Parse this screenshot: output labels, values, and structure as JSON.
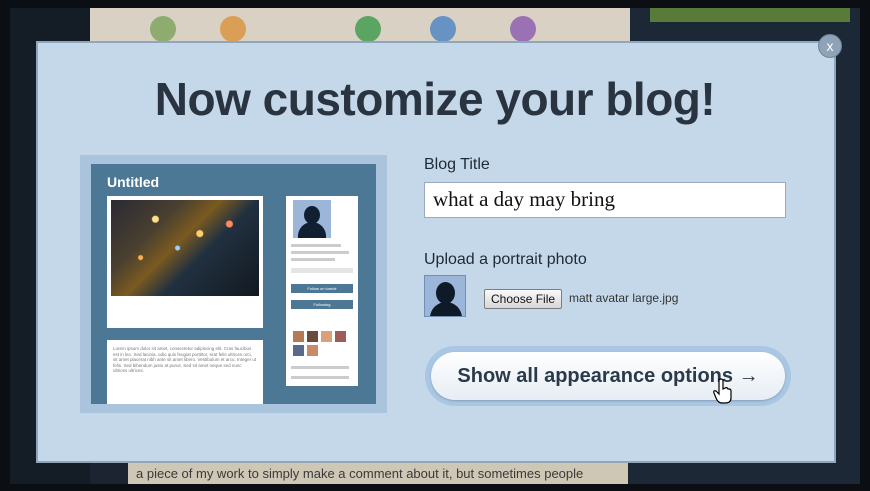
{
  "background": {
    "bottom_text": "a piece of my work to simply make a comment about it, but sometimes people"
  },
  "modal": {
    "close_label": "x",
    "heading": "Now customize your blog!",
    "preview": {
      "blog_name": "Untitled",
      "post_body": "Lorem ipsum dolor sit amet, consectetur adipiscing elit. Cras faucibus est in leo. Sed lacinia, odio quis feugiat porttitor, erat felis ultrices orci, sit amet placerat nibh ante sit amet libero. Vestibulum et arcu. Integer ut felis. Sed bibendum justo at purus. Sed sit amet neque sed nunc ultrices ultrices.",
      "follow_label": "Follow on tumblr",
      "following_label": "Following"
    },
    "blog_title_label": "Blog Title",
    "blog_title_value": "what a day may bring",
    "upload_label": "Upload a portrait photo",
    "choose_file_label": "Choose File",
    "file_name": "matt avatar large.jpg",
    "show_options_label": "Show all appearance options →"
  },
  "colors": {
    "modal_bg": "#c4d8ea",
    "heading": "#2a3440",
    "preview_theme": "#4d7895"
  },
  "icons": [
    "close-icon",
    "portrait-silhouette-icon",
    "hand-cursor-icon"
  ]
}
